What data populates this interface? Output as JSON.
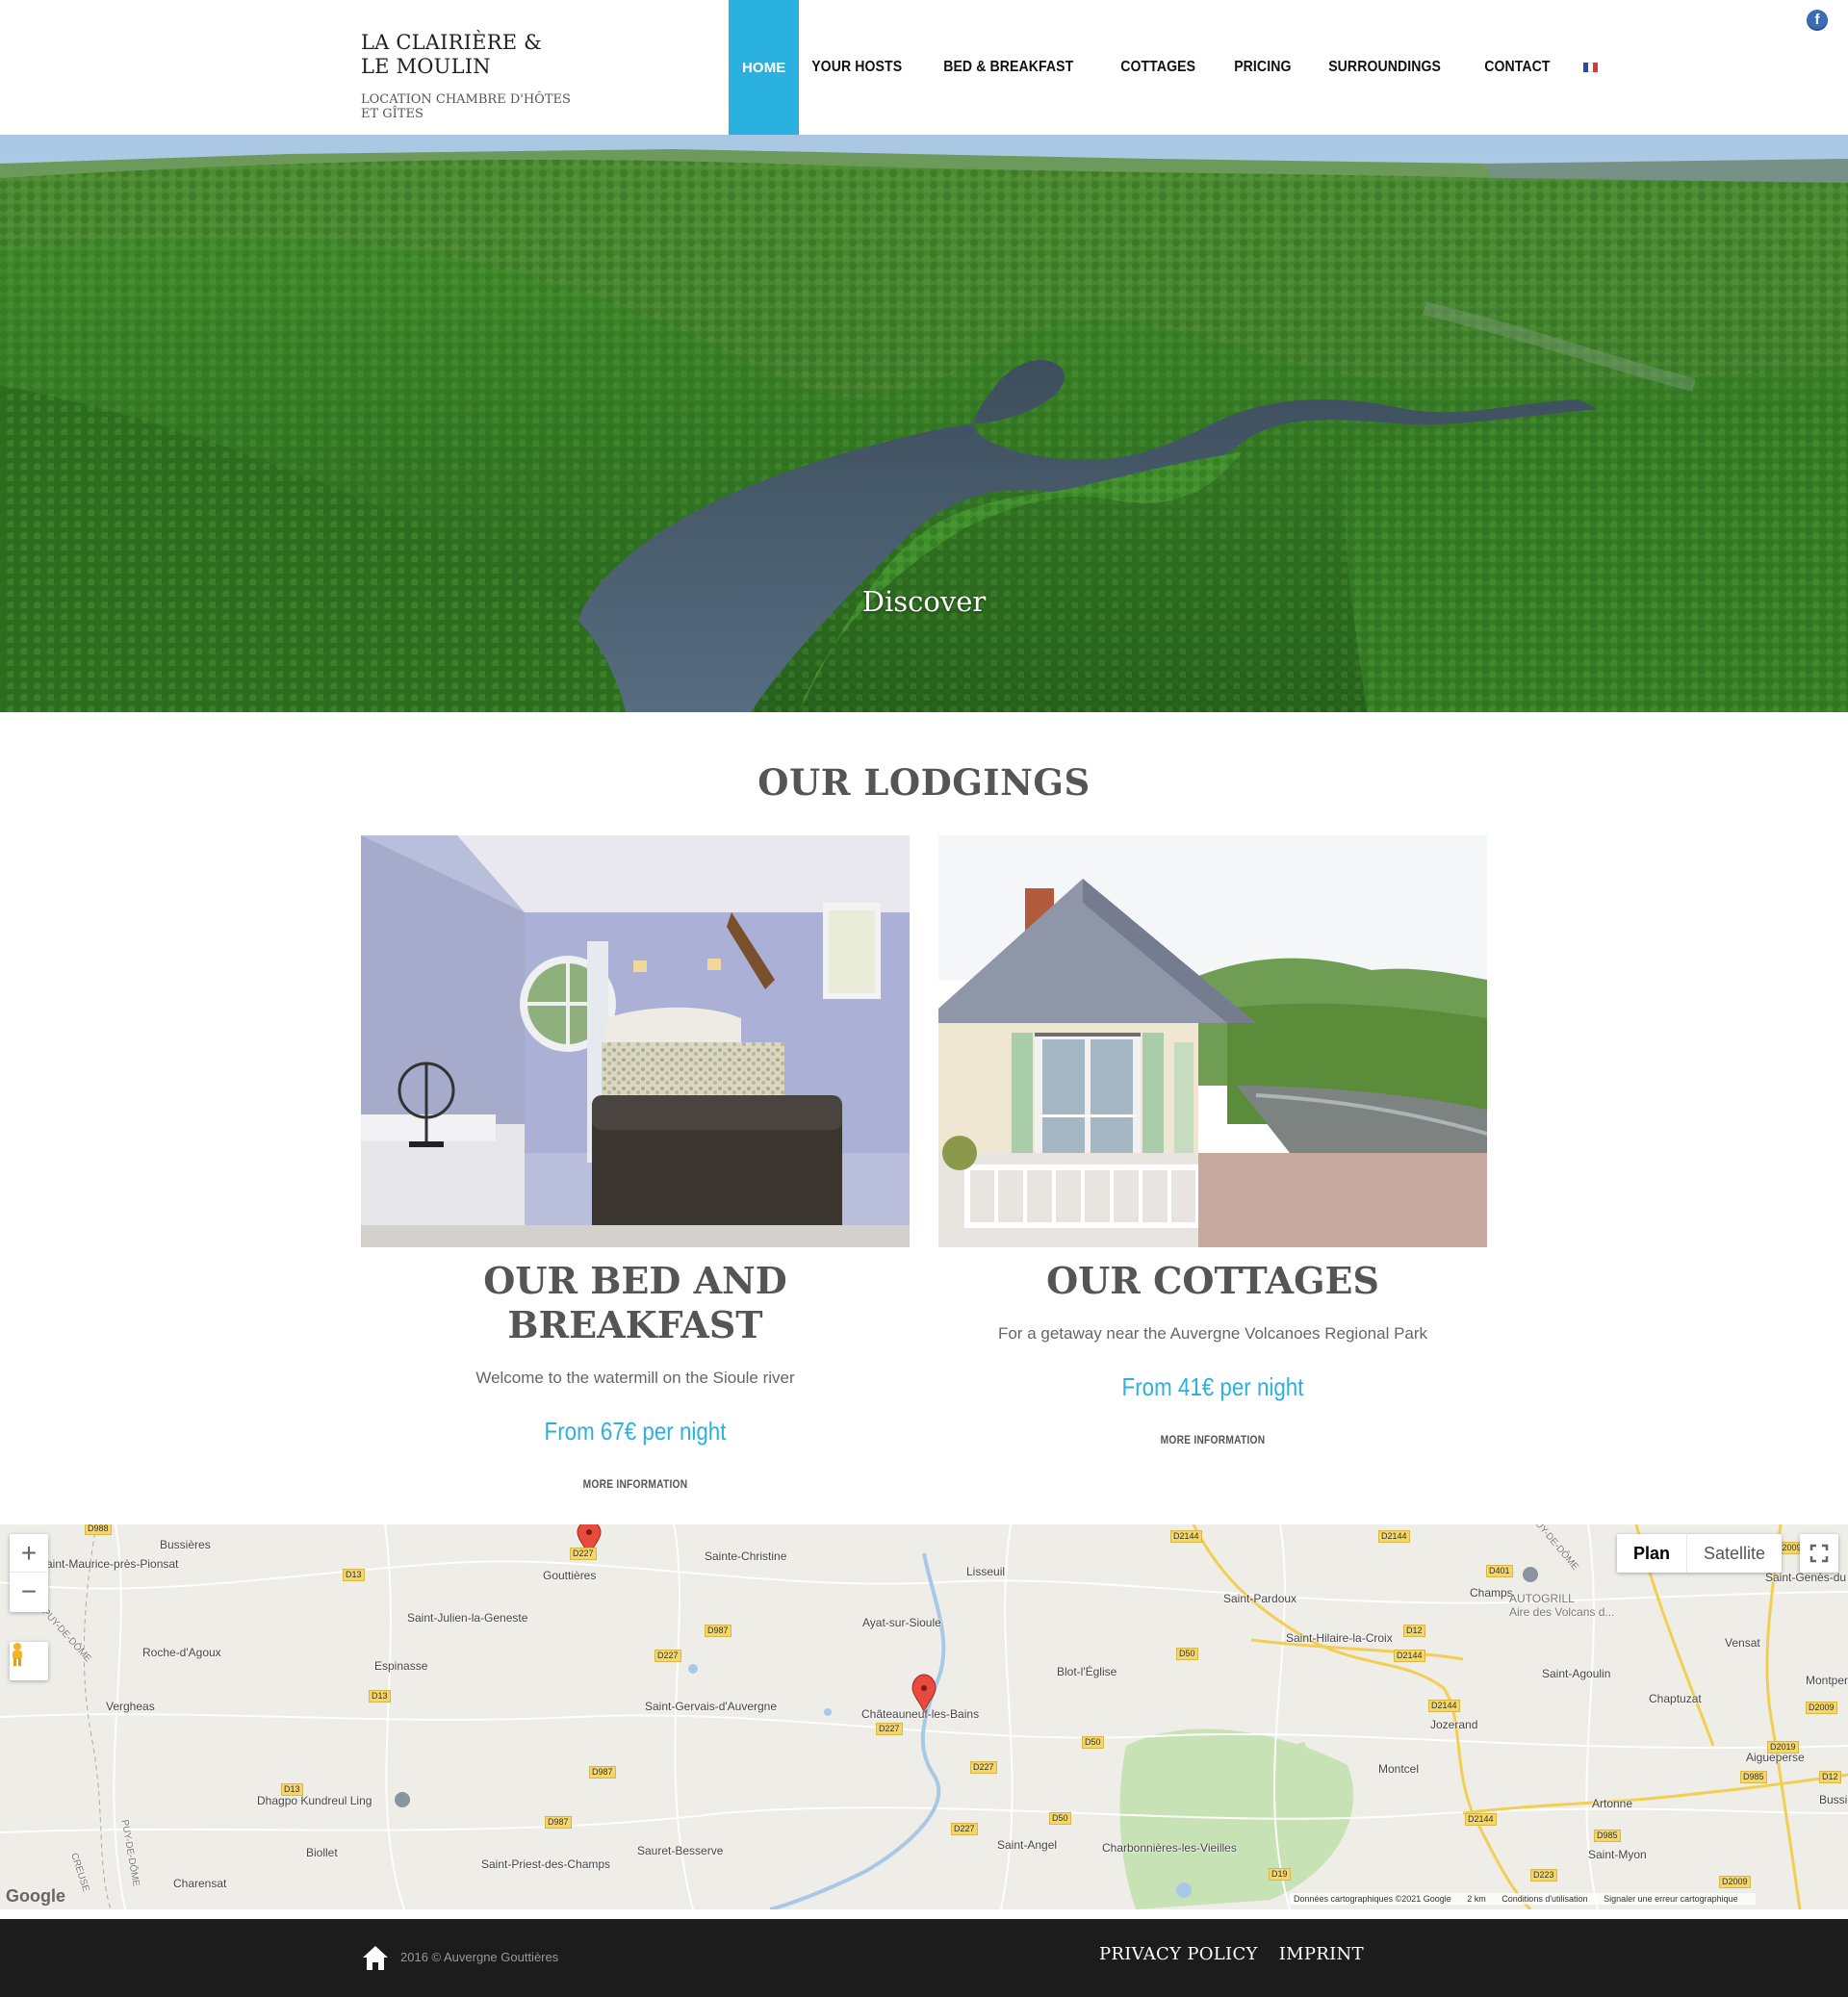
{
  "brand": {
    "title_line1": "LA CLAIRIÈRE &",
    "title_line2": "LE MOULIN",
    "subtitle": "LOCATION CHAMBRE D'HÔTES ET GÎTES"
  },
  "nav": {
    "items": [
      {
        "label": "HOME",
        "active": true
      },
      {
        "label": "YOUR HOSTS"
      },
      {
        "label": "BED & BREAKFAST"
      },
      {
        "label": "COTTAGES"
      },
      {
        "label": "PRICING"
      },
      {
        "label": "SURROUNDINGS"
      },
      {
        "label": "CONTACT"
      }
    ],
    "language_icon": "french-flag-icon",
    "social_icon": "facebook-icon",
    "social_label": "f"
  },
  "hero": {
    "caption": "Discover"
  },
  "lodgings": {
    "title": "OUR LODGINGS",
    "cards": [
      {
        "title": "OUR BED AND BREAKFAST",
        "text": "Welcome to the watermill on the Sioule river",
        "price": "From 67€ per night",
        "more": "MORE INFORMATION"
      },
      {
        "title": "OUR COTTAGES",
        "text": "For a getaway near the Auvergne Volcanoes Regional Park",
        "price": "From 41€ per night",
        "more": "MORE INFORMATION"
      }
    ]
  },
  "map": {
    "zoom_in": "+",
    "zoom_out": "−",
    "type_plan": "Plan",
    "type_satellite": "Satellite",
    "google": "Google",
    "attribution": {
      "data": "Données cartographiques ©2021 Google",
      "scale": "2 km",
      "terms": "Conditions d'utilisation",
      "report": "Signaler une erreur cartographique"
    },
    "places": [
      "Bussières",
      "Saint-Maurice-près-Pionsat",
      "Gouttières",
      "Sainte-Christine",
      "Lisseuil",
      "Saint-Julien-la-Geneste",
      "Roche-d'Agoux",
      "Espinasse",
      "Ayat-sur-Sioule",
      "Vergheas",
      "Saint-Gervais-d'Auvergne",
      "Châteauneuf-les-Bains",
      "Blot-l'Église",
      "Saint-Pardoux",
      "Saint-Hilaire-la-Croix",
      "Champs",
      "AUTOGRILL",
      "Aire des Volcans d...",
      "Vensat",
      "Saint-Agoulin",
      "Chaptuzat",
      "Montpens",
      "Jozerand",
      "Montcel",
      "Aigueperse",
      "Artonne",
      "Bussiè",
      "Saint-Genès-du",
      "Dhagpo Kundreul Ling",
      "Biollet",
      "Charensat",
      "Sauret-Besserve",
      "Saint-Priest-des-Champs",
      "Saint-Angel",
      "Charbonnières-les-Vieilles",
      "Saint-Myon",
      "PUY-DE-DÔME",
      "CREUSE",
      "PUY-DE-DÔME",
      "PUY-DE-DÔME"
    ],
    "roads": [
      "D988",
      "D227",
      "D13",
      "D987",
      "D227",
      "D13",
      "D227",
      "D987",
      "D13",
      "D987",
      "D50",
      "D50",
      "D50",
      "D227",
      "D2144",
      "D401",
      "D12",
      "D2144",
      "D2144",
      "D2144",
      "D2009",
      "D2009",
      "D2019",
      "D985",
      "D12",
      "D985",
      "D223",
      "D2009",
      "D19",
      "D2144",
      "D227"
    ]
  },
  "footer": {
    "home_icon": "home-icon",
    "copyright": "2016 © Auvergne Gouttières",
    "links": [
      "PRIVACY POLICY",
      "IMPRINT"
    ]
  }
}
